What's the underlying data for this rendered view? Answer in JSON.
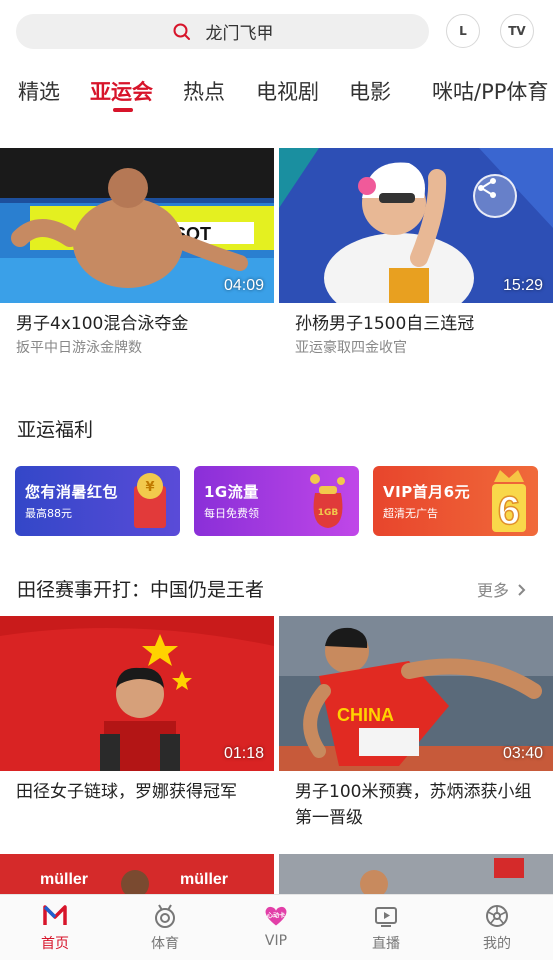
{
  "search": {
    "query": "龙门飞甲"
  },
  "top_buttons": {
    "history": "L",
    "tv": "TV"
  },
  "tabs": [
    {
      "label": "精选"
    },
    {
      "label": "亚运会"
    },
    {
      "label": "热点"
    },
    {
      "label": "电视剧"
    },
    {
      "label": "电影"
    },
    {
      "label": "咪咕/PP体育"
    }
  ],
  "videos_top": [
    {
      "title": "男子4x100混合泳夺金",
      "subtitle": "扳平中日游泳金牌数",
      "duration": "04:09",
      "overlay_text": "TISSOT"
    },
    {
      "title": "孙杨男子1500自三连冠",
      "subtitle": "亚运豪取四金收官",
      "duration": "15:29"
    }
  ],
  "welfare": {
    "title": "亚运福利",
    "banners": [
      {
        "line1": "您有消暑红包",
        "line2": "最高88元",
        "color": "#3b4fcf"
      },
      {
        "line1": "1G流量",
        "line2": "每日免费领",
        "color": "#9c2fd6",
        "badge": "1GB"
      },
      {
        "line1": "VIP首月6元",
        "line2": "超清无广告",
        "color": "#e8452c",
        "badge": "6"
      }
    ]
  },
  "track": {
    "title": "田径赛事开打：中国仍是王者",
    "more": "更多",
    "videos": [
      {
        "title": "田径女子链球，罗娜获得冠军",
        "duration": "01:18"
      },
      {
        "title": "男子100米预赛，苏炳添获小组第一晋级",
        "duration": "03:40",
        "overlay_text": "CHINA"
      }
    ],
    "preview_text": [
      "müller",
      "müller"
    ]
  },
  "bottom_nav": [
    {
      "label": "首页",
      "icon": "home-icon",
      "active": true
    },
    {
      "label": "体育",
      "icon": "medal-icon"
    },
    {
      "label": "VIP",
      "icon": "vip-icon",
      "badge": "心动卡"
    },
    {
      "label": "直播",
      "icon": "live-icon"
    },
    {
      "label": "我的",
      "icon": "profile-icon"
    }
  ],
  "colors": {
    "accent": "#d7142a"
  }
}
